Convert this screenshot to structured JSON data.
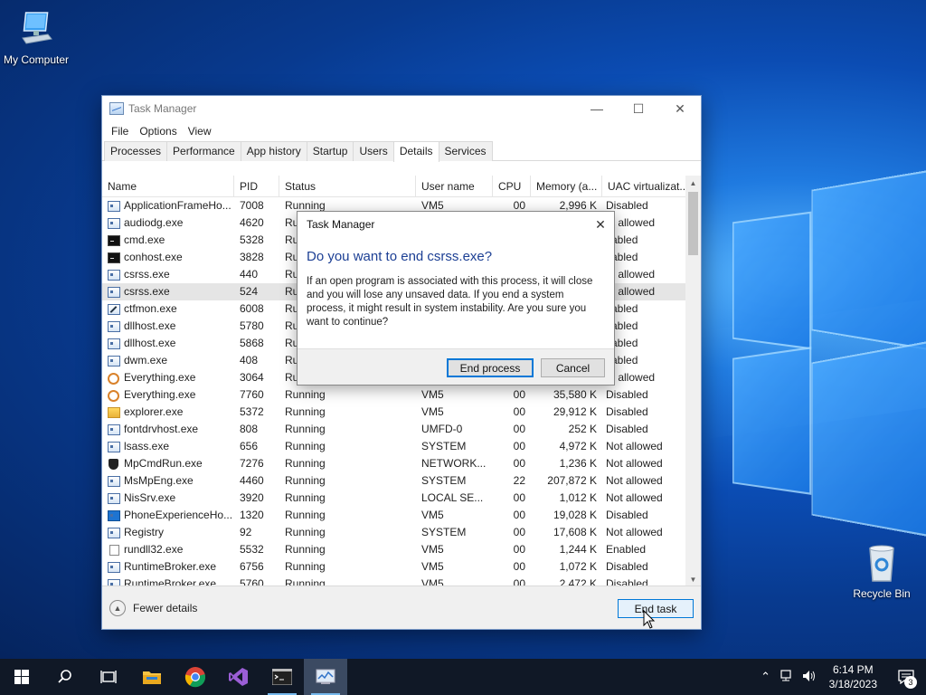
{
  "desktop": {
    "icons": [
      {
        "label": "My Computer",
        "icon": "computer-icon"
      },
      {
        "label": "Recycle Bin",
        "icon": "recycle-bin-icon"
      }
    ]
  },
  "task_manager": {
    "title": "Task Manager",
    "menu": [
      "File",
      "Options",
      "View"
    ],
    "tabs": [
      "Processes",
      "Performance",
      "App history",
      "Startup",
      "Users",
      "Details",
      "Services"
    ],
    "active_tab": "Details",
    "columns": [
      "Name",
      "PID",
      "Status",
      "User name",
      "CPU",
      "Memory (a...",
      "UAC virtualizat..."
    ],
    "rows": [
      {
        "name": "ApplicationFrameHo...",
        "pid": "7008",
        "status": "Running",
        "user": "VM5",
        "cpu": "00",
        "mem": "2,996 K",
        "uac": "Disabled",
        "icon": "app"
      },
      {
        "name": "audiodg.exe",
        "pid": "4620",
        "status": "Ru",
        "user": "",
        "cpu": "",
        "mem": "",
        "uac": "ot allowed",
        "icon": "app"
      },
      {
        "name": "cmd.exe",
        "pid": "5328",
        "status": "Ru",
        "user": "",
        "cpu": "",
        "mem": "",
        "uac": "sabled",
        "icon": "cmd"
      },
      {
        "name": "conhost.exe",
        "pid": "3828",
        "status": "Ru",
        "user": "",
        "cpu": "",
        "mem": "",
        "uac": "sabled",
        "icon": "cmd"
      },
      {
        "name": "csrss.exe",
        "pid": "440",
        "status": "Ru",
        "user": "",
        "cpu": "",
        "mem": "",
        "uac": "ot allowed",
        "icon": "app"
      },
      {
        "name": "csrss.exe",
        "pid": "524",
        "status": "Ru",
        "user": "",
        "cpu": "",
        "mem": "",
        "uac": "ot allowed",
        "icon": "app",
        "selected": true
      },
      {
        "name": "ctfmon.exe",
        "pid": "6008",
        "status": "Ru",
        "user": "",
        "cpu": "",
        "mem": "",
        "uac": "sabled",
        "icon": "pen"
      },
      {
        "name": "dllhost.exe",
        "pid": "5780",
        "status": "Ru",
        "user": "",
        "cpu": "",
        "mem": "",
        "uac": "sabled",
        "icon": "app"
      },
      {
        "name": "dllhost.exe",
        "pid": "5868",
        "status": "Ru",
        "user": "",
        "cpu": "",
        "mem": "",
        "uac": "sabled",
        "icon": "app"
      },
      {
        "name": "dwm.exe",
        "pid": "408",
        "status": "Ru",
        "user": "",
        "cpu": "",
        "mem": "",
        "uac": "sabled",
        "icon": "app"
      },
      {
        "name": "Everything.exe",
        "pid": "3064",
        "status": "Ru",
        "user": "",
        "cpu": "",
        "mem": "",
        "uac": "ot allowed",
        "icon": "key"
      },
      {
        "name": "Everything.exe",
        "pid": "7760",
        "status": "Running",
        "user": "VM5",
        "cpu": "00",
        "mem": "35,580 K",
        "uac": "Disabled",
        "icon": "key"
      },
      {
        "name": "explorer.exe",
        "pid": "5372",
        "status": "Running",
        "user": "VM5",
        "cpu": "00",
        "mem": "29,912 K",
        "uac": "Disabled",
        "icon": "folder"
      },
      {
        "name": "fontdrvhost.exe",
        "pid": "808",
        "status": "Running",
        "user": "UMFD-0",
        "cpu": "00",
        "mem": "252 K",
        "uac": "Disabled",
        "icon": "app"
      },
      {
        "name": "lsass.exe",
        "pid": "656",
        "status": "Running",
        "user": "SYSTEM",
        "cpu": "00",
        "mem": "4,972 K",
        "uac": "Not allowed",
        "icon": "app"
      },
      {
        "name": "MpCmdRun.exe",
        "pid": "7276",
        "status": "Running",
        "user": "NETWORK...",
        "cpu": "00",
        "mem": "1,236 K",
        "uac": "Not allowed",
        "icon": "shield"
      },
      {
        "name": "MsMpEng.exe",
        "pid": "4460",
        "status": "Running",
        "user": "SYSTEM",
        "cpu": "22",
        "mem": "207,872 K",
        "uac": "Not allowed",
        "icon": "app"
      },
      {
        "name": "NisSrv.exe",
        "pid": "3920",
        "status": "Running",
        "user": "LOCAL SE...",
        "cpu": "00",
        "mem": "1,012 K",
        "uac": "Not allowed",
        "icon": "app"
      },
      {
        "name": "PhoneExperienceHo...",
        "pid": "1320",
        "status": "Running",
        "user": "VM5",
        "cpu": "00",
        "mem": "19,028 K",
        "uac": "Disabled",
        "icon": "phone"
      },
      {
        "name": "Registry",
        "pid": "92",
        "status": "Running",
        "user": "SYSTEM",
        "cpu": "00",
        "mem": "17,608 K",
        "uac": "Not allowed",
        "icon": "app"
      },
      {
        "name": "rundll32.exe",
        "pid": "5532",
        "status": "Running",
        "user": "VM5",
        "cpu": "00",
        "mem": "1,244 K",
        "uac": "Enabled",
        "icon": "page"
      },
      {
        "name": "RuntimeBroker.exe",
        "pid": "6756",
        "status": "Running",
        "user": "VM5",
        "cpu": "00",
        "mem": "1,072 K",
        "uac": "Disabled",
        "icon": "app"
      },
      {
        "name": "RuntimeBroker.exe",
        "pid": "5760",
        "status": "Running",
        "user": "VM5",
        "cpu": "00",
        "mem": "2,472 K",
        "uac": "Disabled",
        "icon": "app"
      }
    ],
    "fewer_details": "Fewer details",
    "end_task": "End task"
  },
  "dialog": {
    "title": "Task Manager",
    "heading": "Do you want to end csrss.exe?",
    "body": "If an open program is associated with this process, it will close and you will lose any unsaved data. If you end a system process, it might result in system instability. Are you sure you want to continue?",
    "primary": "End process",
    "secondary": "Cancel"
  },
  "taskbar": {
    "apps": [
      "start-icon",
      "search-icon",
      "task-view-icon",
      "file-explorer-icon",
      "chrome-icon",
      "visual-studio-icon",
      "terminal-icon",
      "task-manager-icon"
    ],
    "time": "6:14 PM",
    "date": "3/18/2023",
    "notifications": "3"
  }
}
